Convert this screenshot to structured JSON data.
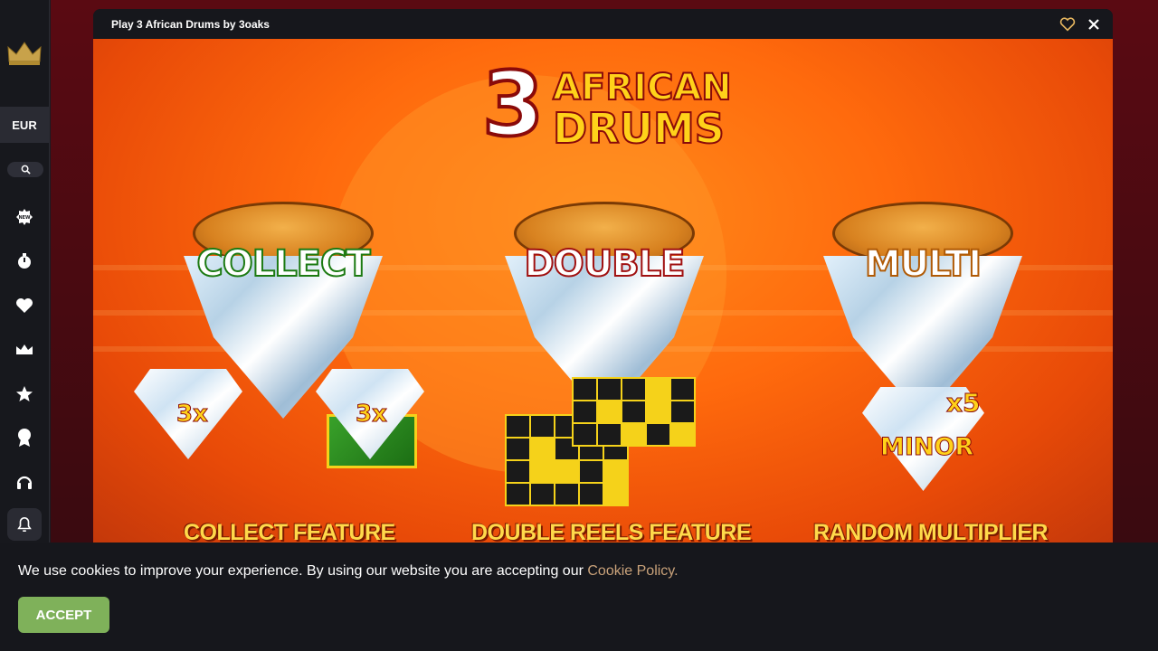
{
  "sidebar": {
    "currency": "EUR",
    "icons": [
      "crown-logo",
      "search-icon",
      "new-badge-icon",
      "stopwatch-icon",
      "heart-icon",
      "crown-icon",
      "star-icon",
      "award-icon",
      "headset-icon",
      "bell-icon"
    ]
  },
  "game": {
    "window_title": "Play 3 African Drums by 3oaks",
    "logo": {
      "number": "3",
      "line1": "AFRICAN",
      "line2": "DRUMS"
    },
    "drums": [
      {
        "label": "COLLECT",
        "caption": "COLLECT FEATURE",
        "gem_left": "3x",
        "gem_right": "3x"
      },
      {
        "label": "DOUBLE",
        "caption": "DOUBLE REELS FEATURE"
      },
      {
        "label": "MULTI",
        "caption": "RANDOM MULTIPLIER",
        "multiplier": "x5",
        "tier": "MINOR"
      }
    ]
  },
  "cookie": {
    "message": "We use cookies to improve your experience. By using our website you are accepting our ",
    "link_text": "Cookie Policy.",
    "accept_label": "ACCEPT"
  },
  "colors": {
    "accent_green": "#7fb15a",
    "link": "#c9a27a",
    "caption_yellow": "#ffd94a"
  }
}
